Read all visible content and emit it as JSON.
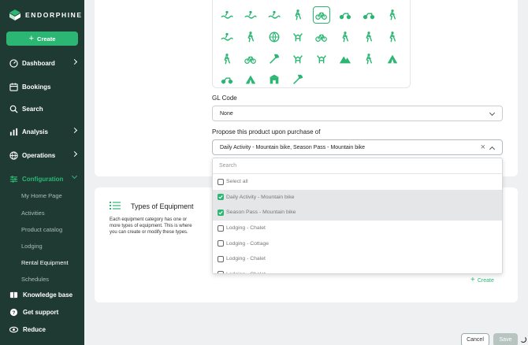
{
  "app": {
    "name": "ENDORPHINE"
  },
  "colors": {
    "accent": "#2bb673",
    "sidebar_bg": "#1f3a33"
  },
  "sidebar": {
    "create_label": "Create",
    "items": [
      {
        "label": "Dashboard",
        "icon": "dashboard-icon"
      },
      {
        "label": "Bookings",
        "icon": "calendar-icon"
      },
      {
        "label": "Search",
        "icon": "search-icon"
      },
      {
        "label": "Analysis",
        "icon": "bar-chart-icon"
      },
      {
        "label": "Operations",
        "icon": "globe-icon"
      },
      {
        "label": "Configuration",
        "icon": "sliders-icon"
      }
    ],
    "sub_items": [
      "My Home Page",
      "Activities",
      "Product catalog",
      "Lodging",
      "Rental Equipment",
      "Schedules"
    ],
    "bottom": [
      {
        "label": "Knowledge base",
        "icon": "book-icon"
      },
      {
        "label": "Get support",
        "icon": "help-icon"
      },
      {
        "label": "Reduce",
        "icon": "eye-icon"
      }
    ]
  },
  "form": {
    "gl_code": {
      "label": "GL Code",
      "value": "None"
    },
    "propose": {
      "label": "Propose this product upon purchase of",
      "value": "Daily Activity - Mountain bike, Season Pass - Mountain bike",
      "search_placeholder": "Search",
      "options": [
        {
          "label": "Select all",
          "checked": false
        },
        {
          "label": "Daily Activity - Mountain bike",
          "checked": true
        },
        {
          "label": "Season Pass - Mountain bike",
          "checked": true
        },
        {
          "label": "Lodging - Chalet",
          "checked": false
        },
        {
          "label": "Lodging - Cottage",
          "checked": false
        },
        {
          "label": "Lodging - Chalet",
          "checked": false
        },
        {
          "label": "Lodging - Chalet",
          "checked": false
        }
      ]
    }
  },
  "equipment": {
    "title": "Types of Equipment",
    "description": "Each equipment category has one or more types of equipment. This is where you can create or modify these types.",
    "create_label": "Create"
  },
  "footer": {
    "cancel_label": "Cancel",
    "save_label": "Save"
  },
  "icon_grid": [
    "surf-icon",
    "swim-icon",
    "kayak-icon",
    "fishing-icon",
    "bicycle-icon",
    "scooter-icon",
    "motorbike-icon",
    "hiking-icon",
    "waterski-icon",
    "climbing-icon",
    "basketball-icon",
    "horse-icon",
    "tandem-bike-icon",
    "skier-icon",
    "cross-country-ski-icon",
    "hiker-pole-icon",
    "walker-icon",
    "mountain-bike-icon",
    "skate-icon",
    "deer-icon",
    "moose-icon",
    "zipline-icon",
    "archery-icon",
    "tent-icon",
    "snowmobile-icon",
    "camp-icon",
    "shop-icon",
    "tools-icon"
  ]
}
